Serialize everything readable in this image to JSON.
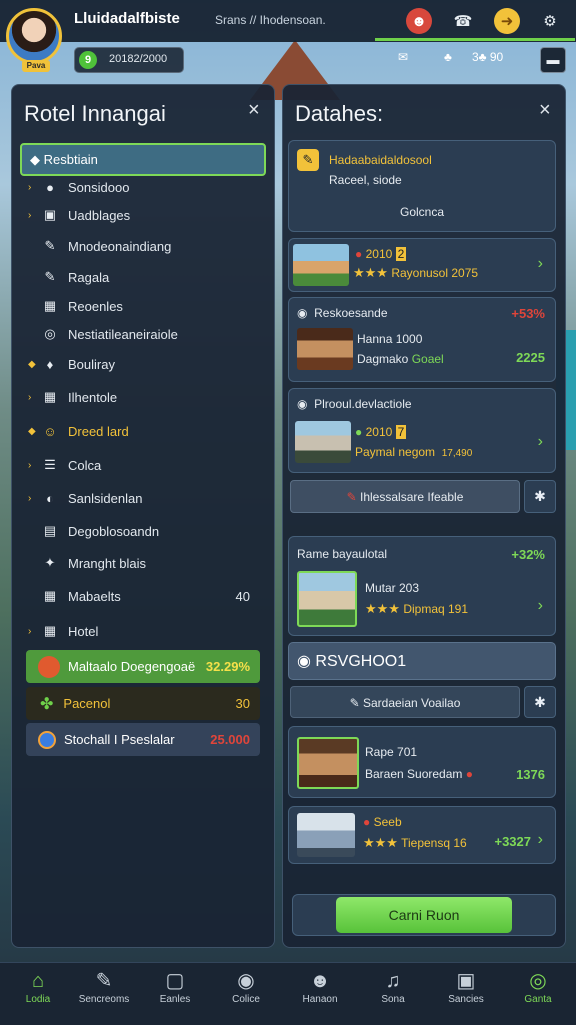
{
  "header": {
    "title": "Lluidadalfbiste",
    "subtitle": "Srans // Ihodensoan.",
    "avatar_tag": "Pava",
    "currency_amount": "20182/2000",
    "currency_coin": "9",
    "mini_a": "✉",
    "mini_b": "♣",
    "mini_c": "3♣ 90",
    "top_icons": [
      "person-icon",
      "notification-icon",
      "clock-icon",
      "gear-icon"
    ]
  },
  "left_panel": {
    "title": "Rotel Innangai",
    "close": "×",
    "selected": "Resbtiain",
    "items": [
      {
        "label": "Sonsidooo",
        "arrow": "›",
        "icon": "●"
      },
      {
        "label": "Uadblages",
        "arrow": "›",
        "icon": "▣"
      },
      {
        "label": "Mnodeonaindiang",
        "arrow": "",
        "icon": "✎"
      },
      {
        "label": "Ragala",
        "arrow": "",
        "icon": "✎"
      },
      {
        "label": "Reoenles",
        "arrow": "",
        "icon": "▦"
      },
      {
        "label": "Nestiatileaneiraiole",
        "arrow": "",
        "icon": "◎"
      },
      {
        "label": "Bouliray",
        "arrow": "◆",
        "icon": "♦"
      },
      {
        "label": "Ilhentole",
        "arrow": "›",
        "icon": "▦"
      },
      {
        "label": "Dreed lard",
        "arrow": "◆",
        "icon": "☺"
      },
      {
        "label": "Colca",
        "arrow": "›",
        "icon": "☰"
      },
      {
        "label": "Sanlsidenlan",
        "arrow": "›",
        "icon": "◐"
      },
      {
        "label": "Degoblosoandn",
        "arrow": "",
        "icon": "▤"
      },
      {
        "label": "Mranght blais",
        "arrow": "",
        "icon": "✦"
      },
      {
        "label": "Mabaelts",
        "arrow": "",
        "icon": "▦",
        "value": "40"
      },
      {
        "label": "Hotel",
        "arrow": "›",
        "icon": "▦"
      }
    ],
    "rows": [
      {
        "label": "Maltaalo Doegengoaë",
        "value": "32.29%"
      },
      {
        "label": "Pacenol",
        "value": "30"
      },
      {
        "label": "Stochall I Pseslalar",
        "value": "25.000"
      }
    ]
  },
  "right_panel": {
    "title": "Datahes:",
    "close": "×",
    "card1": {
      "title": "Hadaabaidaldosool",
      "sub": "Raceel, siode",
      "button": "Golcnca"
    },
    "card2": {
      "price": "2010",
      "tag": "2",
      "stars": "★★★",
      "text": "Rayonusol 2075"
    },
    "card3": {
      "title": "Reskoesande",
      "pct": "+53%",
      "line1": "Hanna 1000",
      "line2": "Dagmako",
      "line2b": "Goael",
      "val": "2225"
    },
    "card4": {
      "title": "Plrooul.devlactiole",
      "price": "2010",
      "tag": "7",
      "text": "Paymal negom",
      "val": "17,490"
    },
    "search_btn": "Ihlessalsare Ifeable",
    "section": {
      "title": "Rame bayaulotal",
      "pct": "+32%"
    },
    "card5": {
      "line1": "Mutar 203",
      "stars": "★★★",
      "text": "Dipmaq 191"
    },
    "banner": "RSVGHOO1",
    "search_btn2": "Sardaeian Voailao",
    "card6": {
      "line1": "Rape 701",
      "line2": "Baraen Suoredam",
      "val": "1376"
    },
    "card7": {
      "price": "Seeb",
      "stars": "★★★",
      "text": "Tiepensq 16",
      "val": "+3327"
    },
    "action": "Carni Ruon"
  },
  "nav": [
    {
      "label": "Lodia",
      "icon": "⌂",
      "active": true
    },
    {
      "label": "Sencreoms",
      "icon": "✎"
    },
    {
      "label": "Eanles",
      "icon": "▢"
    },
    {
      "label": "Colice",
      "icon": "◉"
    },
    {
      "label": "Hanaon",
      "icon": "☻"
    },
    {
      "label": "Sona",
      "icon": "♫"
    },
    {
      "label": "Sancies",
      "icon": "▣"
    },
    {
      "label": "Ganta",
      "icon": "◎",
      "active": true
    }
  ],
  "colors": {
    "accent_green": "#7ed957",
    "gold": "#f2c23a",
    "red": "#e0453a"
  }
}
